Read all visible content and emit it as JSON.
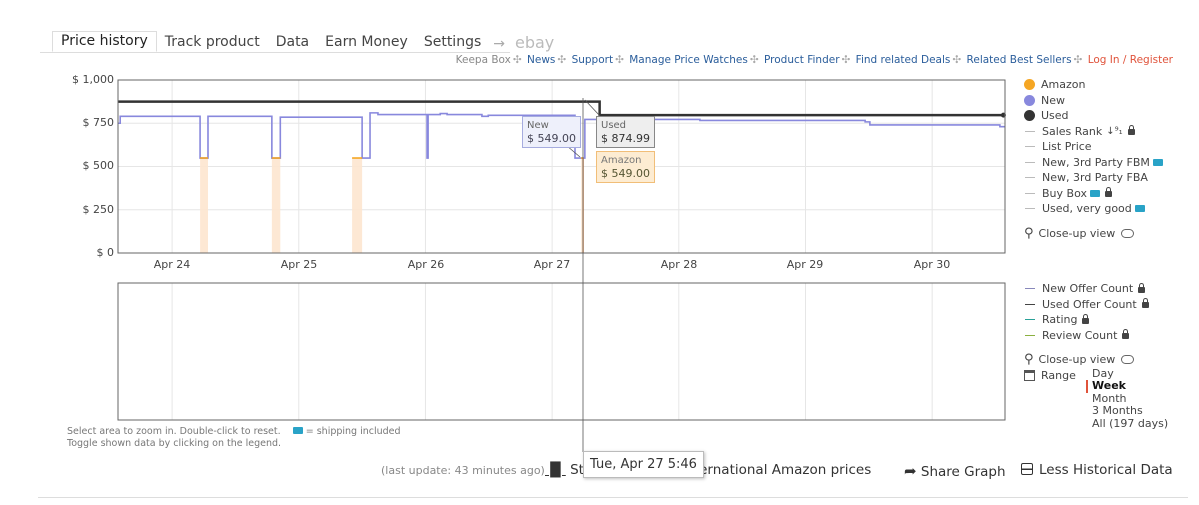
{
  "tabs": [
    {
      "label": "Price history",
      "active": true
    },
    {
      "label": "Track product"
    },
    {
      "label": "Data"
    },
    {
      "label": "Earn Money"
    },
    {
      "label": "Settings"
    }
  ],
  "tabs_arrow": "→",
  "tabs_ebay": "ebay",
  "links": {
    "keepa_box": "Keepa Box",
    "items": [
      "News",
      "Support",
      "Manage Price Watches",
      "Product Finder",
      "Find related Deals",
      "Related Best Sellers"
    ],
    "login": "Log In / Register",
    "separator": "✣"
  },
  "legend_top": {
    "items": [
      {
        "label": "Amazon",
        "marker": "dot",
        "color": "#f5a623"
      },
      {
        "label": "New",
        "marker": "dot",
        "color": "#8888dd"
      },
      {
        "label": "Used",
        "marker": "dot",
        "color": "#333333"
      },
      {
        "label": "Sales Rank",
        "marker": "dash",
        "sort_icon": "↓⁹₁",
        "lock": true
      },
      {
        "label": "List Price",
        "marker": "dash"
      },
      {
        "label": "New, 3rd Party FBM",
        "marker": "dash",
        "truck": true
      },
      {
        "label": "New, 3rd Party FBA",
        "marker": "dash"
      },
      {
        "label": "Buy Box",
        "marker": "dash",
        "truck": true,
        "lock": true
      },
      {
        "label": "Used, very good",
        "marker": "dash",
        "truck": true
      }
    ],
    "closeup": "Close-up view"
  },
  "legend_bottom": {
    "items": [
      {
        "label": "New Offer Count",
        "color": "#8888bb",
        "lock": true
      },
      {
        "label": "Used Offer Count",
        "color": "#444444",
        "lock": true
      },
      {
        "label": "Rating",
        "color": "#2aa198",
        "lock": true
      },
      {
        "label": "Review Count",
        "color": "#8bb040",
        "lock": true
      }
    ],
    "closeup": "Close-up view",
    "range_label": "Range",
    "range_options": [
      "Day",
      "Week",
      "Month",
      "3 Months",
      "All (197 days)"
    ],
    "range_selected": "Week"
  },
  "tooltips": {
    "new": {
      "label": "New",
      "value": "$ 549.00"
    },
    "used": {
      "label": "Used",
      "value": "$ 874.99"
    },
    "amazon": {
      "label": "Amazon",
      "value": "$ 549.00"
    },
    "date": "Tue, Apr 27 5:46"
  },
  "hint": {
    "line1": "Select area to zoom in. Double-click to reset.",
    "shipping": "= shipping included",
    "line2": "Toggle shown data by clicking on the legend."
  },
  "bottom": {
    "last_update": "(last update: 43 minutes ago)",
    "statistics": "Statistics",
    "compare": "Compare international Amazon prices",
    "share": "Share Graph",
    "less": "Less Historical Data"
  },
  "chart_data": {
    "type": "line",
    "ylim": [
      0,
      1000
    ],
    "yticks": [
      "$ 0",
      "$ 250",
      "$ 500",
      "$ 750",
      "$ 1,000"
    ],
    "ytick_values": [
      0,
      250,
      500,
      750,
      1000
    ],
    "xlim": [
      "04-23 13:45",
      "04-30 13:48"
    ],
    "xticks": [
      "Apr 24",
      "Apr 25",
      "Apr 26",
      "Apr 27",
      "Apr 28",
      "Apr 29",
      "Apr 30"
    ],
    "xtick_values": [
      "04-24 00:00",
      "04-25 00:00",
      "04-26 00:00",
      "04-27 00:00",
      "04-28 00:00",
      "04-29 00:00",
      "04-30 00:00"
    ],
    "grid": true,
    "series": [
      {
        "name": "New",
        "color": "#8888dd",
        "step": true,
        "points": [
          [
            "04-23 13:45",
            750
          ],
          [
            "04-23 14:10",
            790
          ],
          [
            "04-24 05:18",
            549
          ],
          [
            "04-24 06:48",
            790
          ],
          [
            "04-24 18:54",
            549
          ],
          [
            "04-24 20:30",
            785
          ],
          [
            "04-25 12:00",
            549
          ],
          [
            "04-25 13:30",
            810
          ],
          [
            "04-25 15:00",
            800
          ],
          [
            "04-26 00:18",
            549
          ],
          [
            "04-26 00:30",
            800
          ],
          [
            "04-26 02:48",
            806
          ],
          [
            "04-26 04:06",
            800
          ],
          [
            "04-26 10:42",
            790
          ],
          [
            "04-26 11:54",
            796
          ],
          [
            "04-27 04:20",
            549
          ],
          [
            "04-27 06:12",
            772
          ],
          [
            "04-28 04:00",
            766
          ],
          [
            "04-29 11:18",
            758
          ],
          [
            "04-29 12:12",
            740
          ],
          [
            "04-30 12:50",
            730
          ],
          [
            "04-30 13:48",
            730
          ]
        ]
      },
      {
        "name": "Used",
        "color": "#333333",
        "step": true,
        "points": [
          [
            "04-23 13:45",
            874.99
          ],
          [
            "04-27 09:00",
            797
          ],
          [
            "04-30 13:30",
            797
          ]
        ]
      },
      {
        "name": "Amazon",
        "color": "#f5a623",
        "step": true,
        "segments": [
          [
            [
              "04-24 05:18",
              549
            ],
            [
              "04-24 06:48",
              549
            ]
          ],
          [
            [
              "04-24 18:54",
              549
            ],
            [
              "04-24 20:30",
              549
            ]
          ],
          [
            [
              "04-25 10:06",
              549
            ],
            [
              "04-25 12:00",
              549
            ]
          ],
          [
            [
              "04-27 05:30",
              549
            ],
            [
              "04-27 05:52",
              549
            ]
          ]
        ]
      }
    ],
    "lower_chart": {
      "series": []
    }
  }
}
